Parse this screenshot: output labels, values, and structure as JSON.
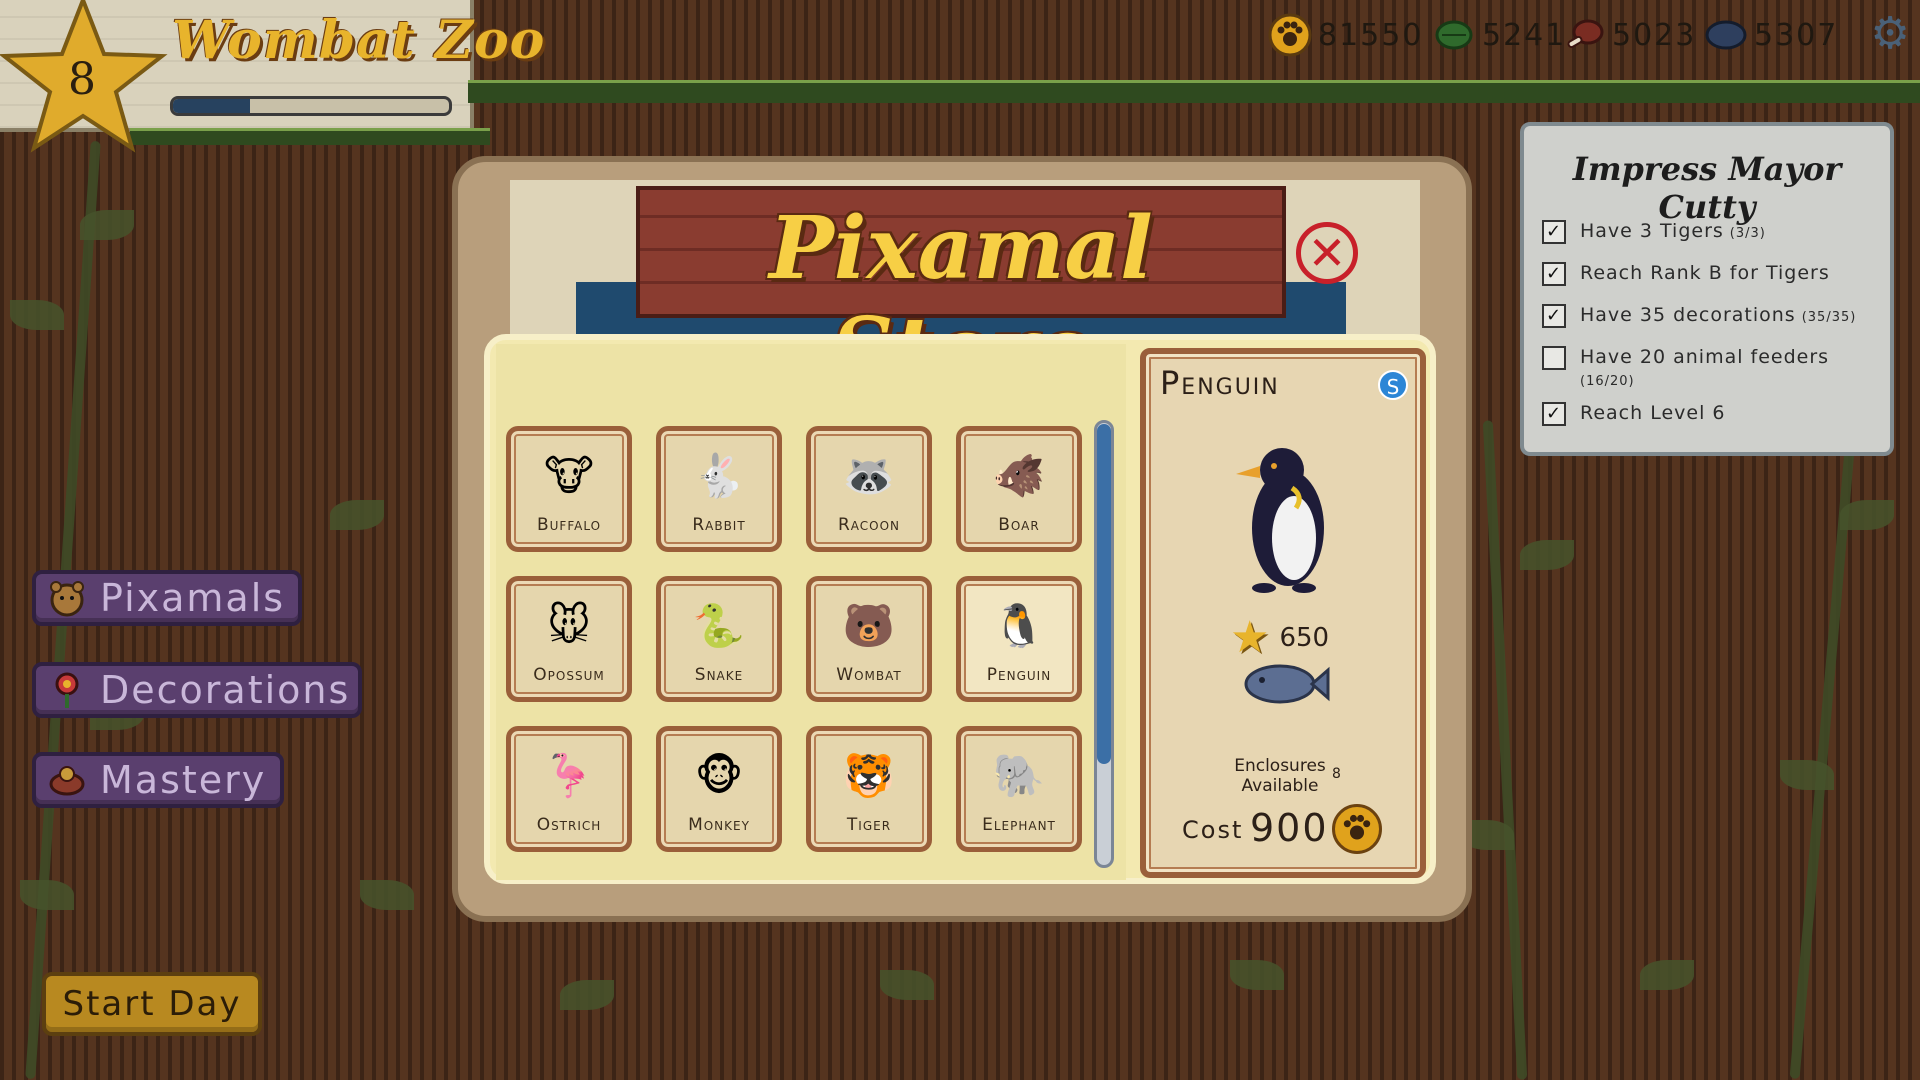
{
  "header": {
    "level": "8",
    "zoo_name": "Wombat Zoo",
    "xp_progress": 0.28
  },
  "resources": [
    {
      "icon": "paw-coin-icon",
      "value": "81550"
    },
    {
      "icon": "leaf-food-icon",
      "value": "5241"
    },
    {
      "icon": "meat-food-icon",
      "value": "5023"
    },
    {
      "icon": "fish-food-icon",
      "value": "5307"
    }
  ],
  "settings_icon": "gear-icon",
  "sidebar": {
    "pixamals_label": "Pixamals",
    "decorations_label": "Decorations",
    "mastery_label": "Mastery",
    "start_day_label": "Start Day"
  },
  "quest": {
    "title": "Impress Mayor Cutty",
    "items": [
      {
        "label": "Have 3 Tigers",
        "progress": "(3/3)",
        "checked": true
      },
      {
        "label": "Reach Rank B for Tigers",
        "progress": "",
        "checked": true
      },
      {
        "label": "Have 35 decorations",
        "progress": "(35/35)",
        "checked": true
      },
      {
        "label": "Have 20 animal feeders",
        "progress": "(16/20)",
        "checked": false
      },
      {
        "label": "Reach Level 6",
        "progress": "",
        "checked": true
      }
    ]
  },
  "store": {
    "title": "Pixamal Store",
    "close_icon": "close-icon",
    "scroll_position": 0.0,
    "animals": [
      {
        "name": "Buffalo",
        "icon": "🐮"
      },
      {
        "name": "Rabbit",
        "icon": "🐇"
      },
      {
        "name": "Racoon",
        "icon": "🦝"
      },
      {
        "name": "Boar",
        "icon": "🐗"
      },
      {
        "name": "Opossum",
        "icon": "🐭"
      },
      {
        "name": "Snake",
        "icon": "🐍"
      },
      {
        "name": "Wombat",
        "icon": "🐻"
      },
      {
        "name": "Penguin",
        "icon": "🐧"
      },
      {
        "name": "Ostrich",
        "icon": "🦩"
      },
      {
        "name": "Monkey",
        "icon": "🐵"
      },
      {
        "name": "Tiger",
        "icon": "🐯"
      },
      {
        "name": "Elephant",
        "icon": "🐘"
      }
    ],
    "selected": {
      "name": "Penguin",
      "rank_badge": "S",
      "star_value": "650",
      "food_icon": "fish-food-icon",
      "enclosures_label": "Enclosures Available",
      "enclosures_value": "8",
      "cost_label": "Cost",
      "cost_value": "900",
      "currency_icon": "paw-coin-icon",
      "sprite_icon": "🐧"
    }
  }
}
